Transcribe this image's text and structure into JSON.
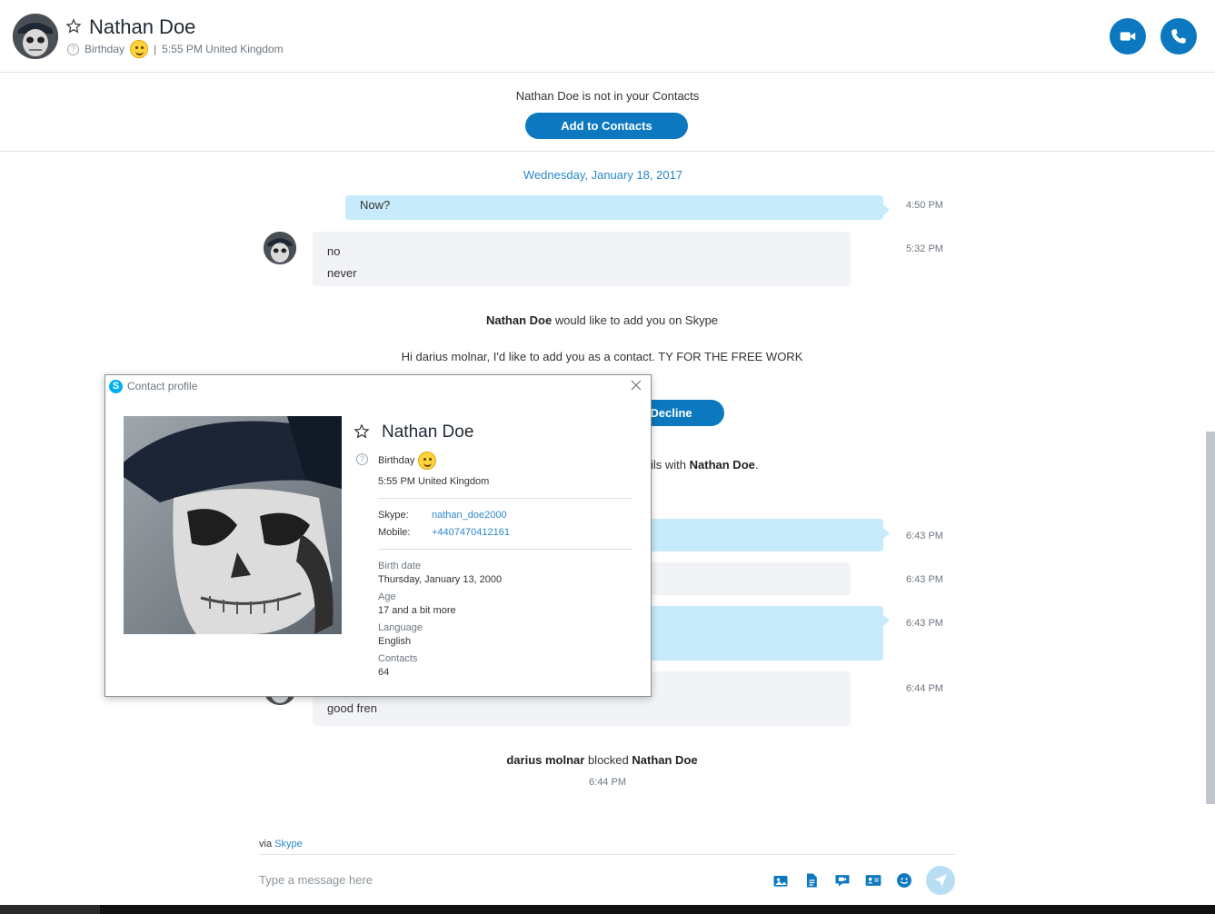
{
  "header": {
    "contact_name": "Nathan Doe",
    "birthday_label": "Birthday",
    "local_time": "5:55 PM United Kingdom",
    "separator": "|"
  },
  "notice": {
    "text": "Nathan Doe is not in your Contacts",
    "add_button": "Add to Contacts"
  },
  "conversation": {
    "date": "Wednesday, January 18, 2017",
    "messages": [
      {
        "direction": "out",
        "lines": [
          "Now?"
        ],
        "time": "4:50 PM"
      },
      {
        "direction": "in",
        "lines": [
          "no",
          "never"
        ],
        "time": "5:32 PM"
      },
      {
        "direction": "out",
        "lines": [],
        "time": "6:43 PM"
      },
      {
        "direction": "in",
        "lines": [],
        "time": "6:43 PM"
      },
      {
        "direction": "out",
        "lines": [],
        "time": "6:43 PM"
      },
      {
        "direction": "in",
        "lines": [
          "good fren"
        ],
        "time": "6:44 PM"
      }
    ],
    "request": {
      "name": "Nathan Doe",
      "text": "would like to add you on Skype",
      "message": "Hi darius molnar, I'd like to add you as a contact. TY FOR THE FREE WORK",
      "decline_button": "Decline"
    },
    "partial_line": {
      "text": "ils with",
      "name": "Nathan Doe",
      "suffix": "."
    },
    "block_event": {
      "actor": "darius molnar",
      "action": "blocked",
      "target": "Nathan Doe",
      "time": "6:44 PM"
    }
  },
  "compose": {
    "via_label": "via",
    "via_link": "Skype",
    "placeholder": "Type a message here",
    "tools": [
      "media-icon",
      "file-icon",
      "video-message-icon",
      "contact-card-icon",
      "emoticon-icon",
      "send-icon"
    ]
  },
  "profile_dialog": {
    "title": "Contact profile",
    "name": "Nathan Doe",
    "birthday_label": "Birthday",
    "local_time": "5:55 PM United Kingdom",
    "skype_label": "Skype:",
    "skype_value": "nathan_doe2000",
    "mobile_label": "Mobile:",
    "mobile_value": "+4407470412161",
    "fields": [
      {
        "label": "Birth date",
        "value": "Thursday, January 13, 2000"
      },
      {
        "label": "Age",
        "value": "17 and a bit more"
      },
      {
        "label": "Language",
        "value": "English"
      },
      {
        "label": "Contacts",
        "value": "64"
      }
    ]
  },
  "colors": {
    "accent": "#0c78c0",
    "link": "#2b88c8",
    "outgoing_bubble": "#c7ebfa",
    "incoming_bubble": "#f1f3f6"
  }
}
